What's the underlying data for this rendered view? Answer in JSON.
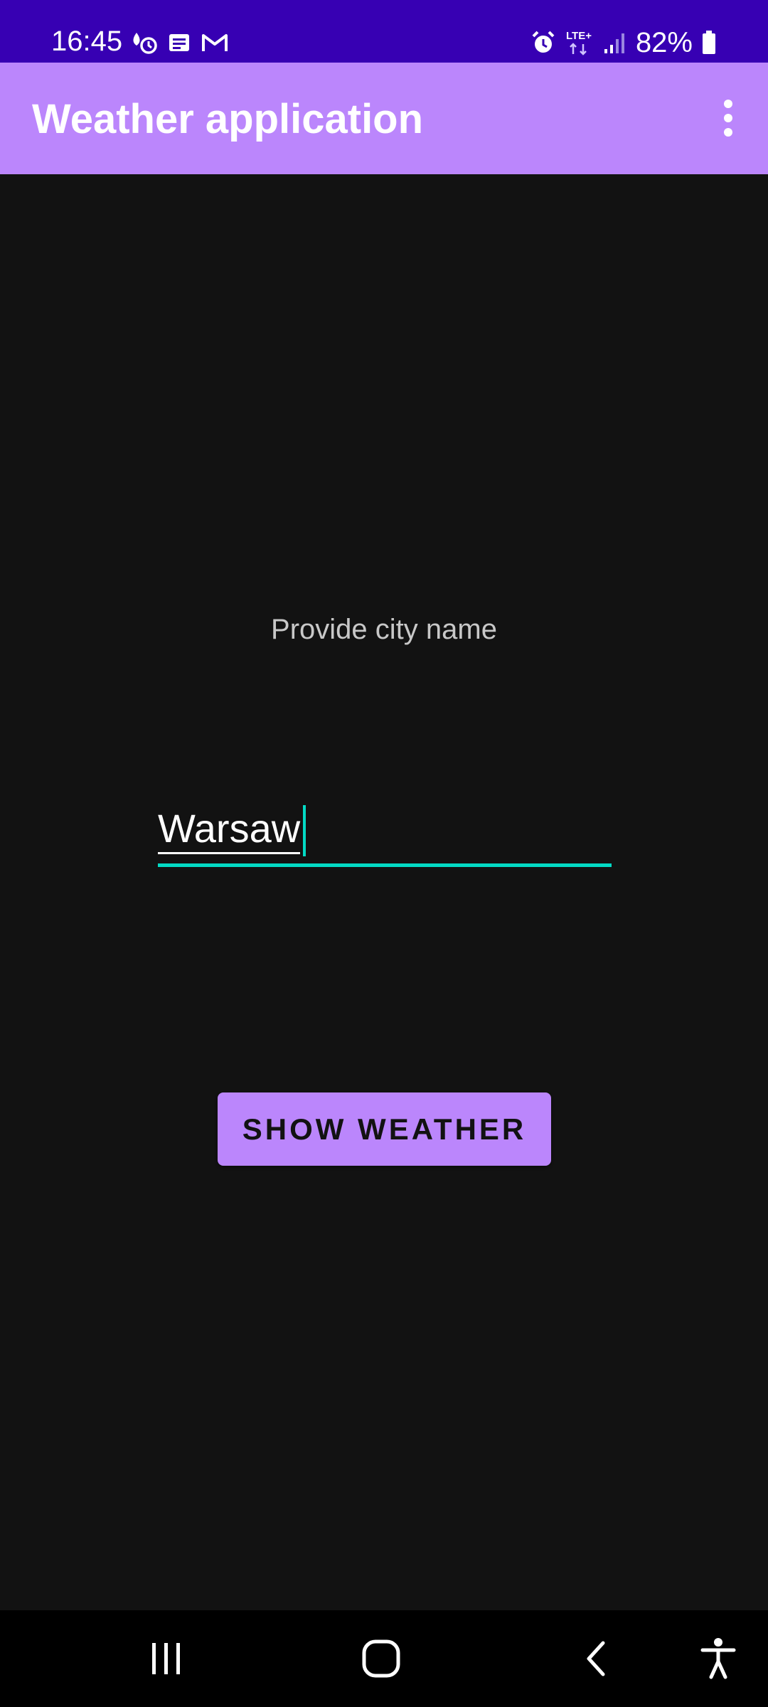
{
  "status_bar": {
    "time": "16:45",
    "battery_percent": "82%",
    "left_icons": [
      "weather-alert-icon",
      "news-icon",
      "gmail-icon"
    ],
    "right_icons": [
      "alarm-icon",
      "lte-plus-icon",
      "signal-icon",
      "battery-icon"
    ],
    "network_label": "LTE+",
    "background_color": "#3700b3"
  },
  "app_bar": {
    "title": "Weather application",
    "menu_icon": "more-vert-icon",
    "background_color": "#bb86fc"
  },
  "main": {
    "prompt": "Provide city name",
    "city_input": {
      "value": "Warsaw",
      "accent_color": "#03dac5"
    },
    "show_button_label": "SHOW WEATHER",
    "button_color": "#bb86fc",
    "background_color": "#121212"
  },
  "nav_bar": {
    "buttons": [
      "recent-apps-icon",
      "home-icon",
      "back-icon",
      "accessibility-icon"
    ]
  }
}
